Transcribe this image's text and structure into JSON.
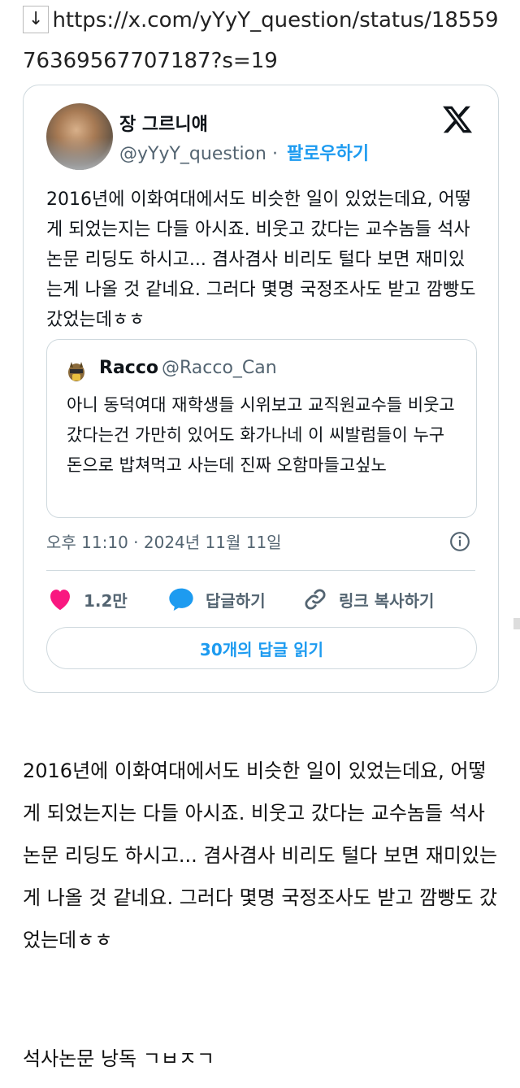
{
  "url": {
    "arrow": "↓",
    "text": "https://x.com/yYyY_question/status/1855976369567707187?s=19"
  },
  "tweet": {
    "author_name": "장 그르니얘",
    "handle": "@yYyY_question",
    "separator": " · ",
    "follow_label": "팔로우하기",
    "text": "2016년에 이화여대에서도 비슷한 일이 있었는데요, 어떻게 되었는지는 다들 아시죠. 비웃고 갔다는 교수놈들 석사논문 리딩도 하시고... 겸사겸사 비리도 털다 보면 재미있는게 나올 것 같네요. 그러다 몇명 국정조사도 받고 깜빵도 갔었는데ㅎㅎ",
    "quote": {
      "name": "Racco",
      "handle": "@Racco_Can",
      "text": "아니 동덕여대 재학생들 시위보고 교직원교수들 비웃고 갔다는건 가만히 있어도 화가나네 이 씨발럼들이 누구 돈으로 밥쳐먹고 사는데 진짜 오함마들고싶노"
    },
    "timestamp": "오후 11:10 · 2024년 11월 11일",
    "actions": {
      "like_count": "1.2만",
      "reply_label": "답글하기",
      "copy_label": "링크 복사하기"
    },
    "read_replies_label": "30개의 답글 읽기",
    "colors": {
      "accent": "#1d9bf0",
      "like": "#f91880",
      "muted": "#536471",
      "border": "#cfd9de"
    },
    "icons": [
      "x-logo-icon",
      "info-icon",
      "heart-icon",
      "reply-bubble-icon",
      "link-icon"
    ]
  },
  "body_text": "2016년에 이화여대에서도 비슷한 일이 있었는데요, 어떻게 되었는지는 다들 아시죠. 비웃고 갔다는 교수놈들 석사논문 리딩도 하시고... 겸사겸사 비리도 털다 보면 재미있는게 나올 것 같네요. 그러다 몇명 국정조사도 받고 깜빵도 갔었는데ㅎㅎ",
  "footer_text": "석사논문 낭독 ㄱㅂㅈㄱ"
}
